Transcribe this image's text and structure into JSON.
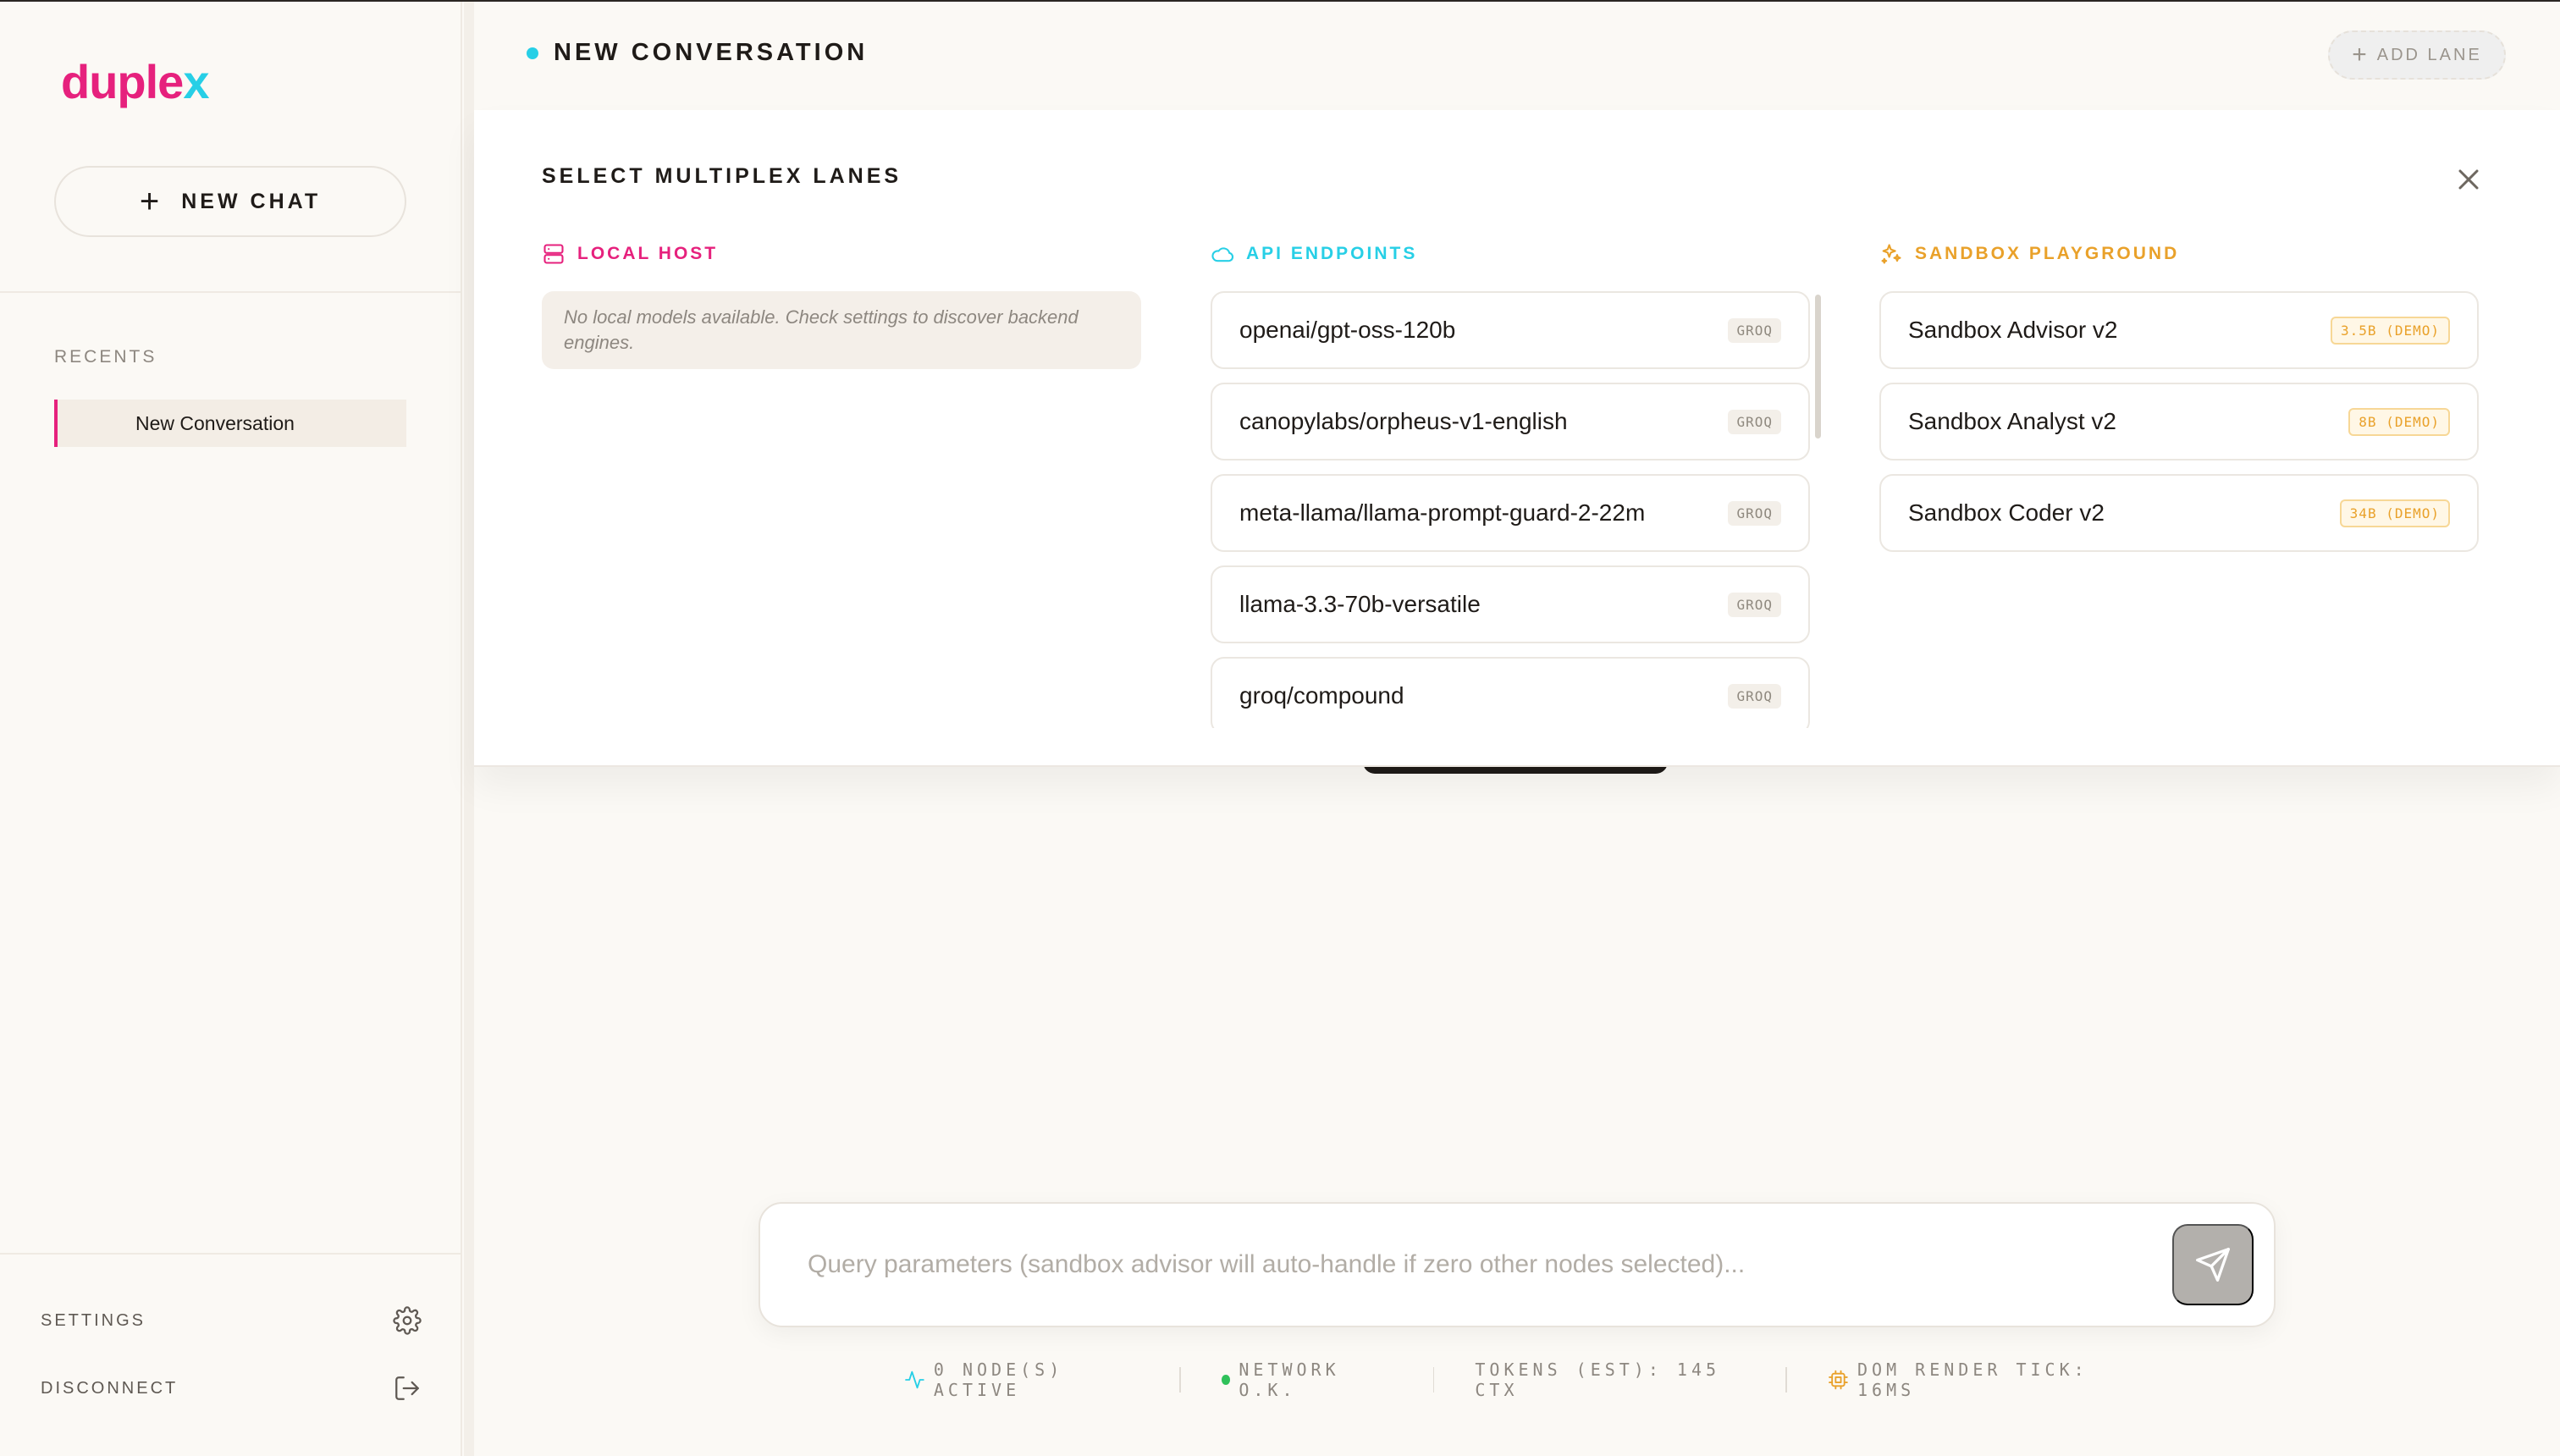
{
  "sidebar": {
    "logo_part1": "duple",
    "logo_part2": "x",
    "new_chat_label": "NEW CHAT",
    "recents_label": "RECENTS",
    "recent_items": [
      {
        "label": "New Conversation"
      }
    ],
    "settings_label": "SETTINGS",
    "disconnect_label": "DISCONNECT"
  },
  "header": {
    "title": "NEW CONVERSATION",
    "add_lane_label": "ADD LANE"
  },
  "modal": {
    "title": "SELECT MULTIPLEX LANES",
    "local": {
      "heading": "LOCAL HOST",
      "empty_message": "No local models available. Check settings to discover backend engines."
    },
    "api": {
      "heading": "API ENDPOINTS",
      "models": [
        {
          "name": "openai/gpt-oss-120b",
          "tag": "GROQ"
        },
        {
          "name": "canopylabs/orpheus-v1-english",
          "tag": "GROQ"
        },
        {
          "name": "meta-llama/llama-prompt-guard-2-22m",
          "tag": "GROQ"
        },
        {
          "name": "llama-3.3-70b-versatile",
          "tag": "GROQ"
        },
        {
          "name": "groq/compound",
          "tag": "GROQ"
        }
      ]
    },
    "sandbox": {
      "heading": "SANDBOX PLAYGROUND",
      "models": [
        {
          "name": "Sandbox Advisor v2",
          "tag": "3.5B (DEMO)"
        },
        {
          "name": "Sandbox Analyst v2",
          "tag": "8B (DEMO)"
        },
        {
          "name": "Sandbox Coder v2",
          "tag": "34B (DEMO)"
        }
      ]
    }
  },
  "composer": {
    "placeholder": "Query parameters (sandbox advisor will auto-handle if zero other nodes selected)...",
    "value": ""
  },
  "status_bar": {
    "nodes": "0 NODE(S) ACTIVE",
    "network": "NETWORK O.K.",
    "tokens": "TOKENS (EST): 145 CTX",
    "render": "DOM RENDER TICK: 16MS"
  },
  "colors": {
    "brand_pink": "#e6217d",
    "brand_cyan": "#27cfe6",
    "sandbox_orange": "#e9a12a",
    "status_green": "#2fc15a"
  }
}
